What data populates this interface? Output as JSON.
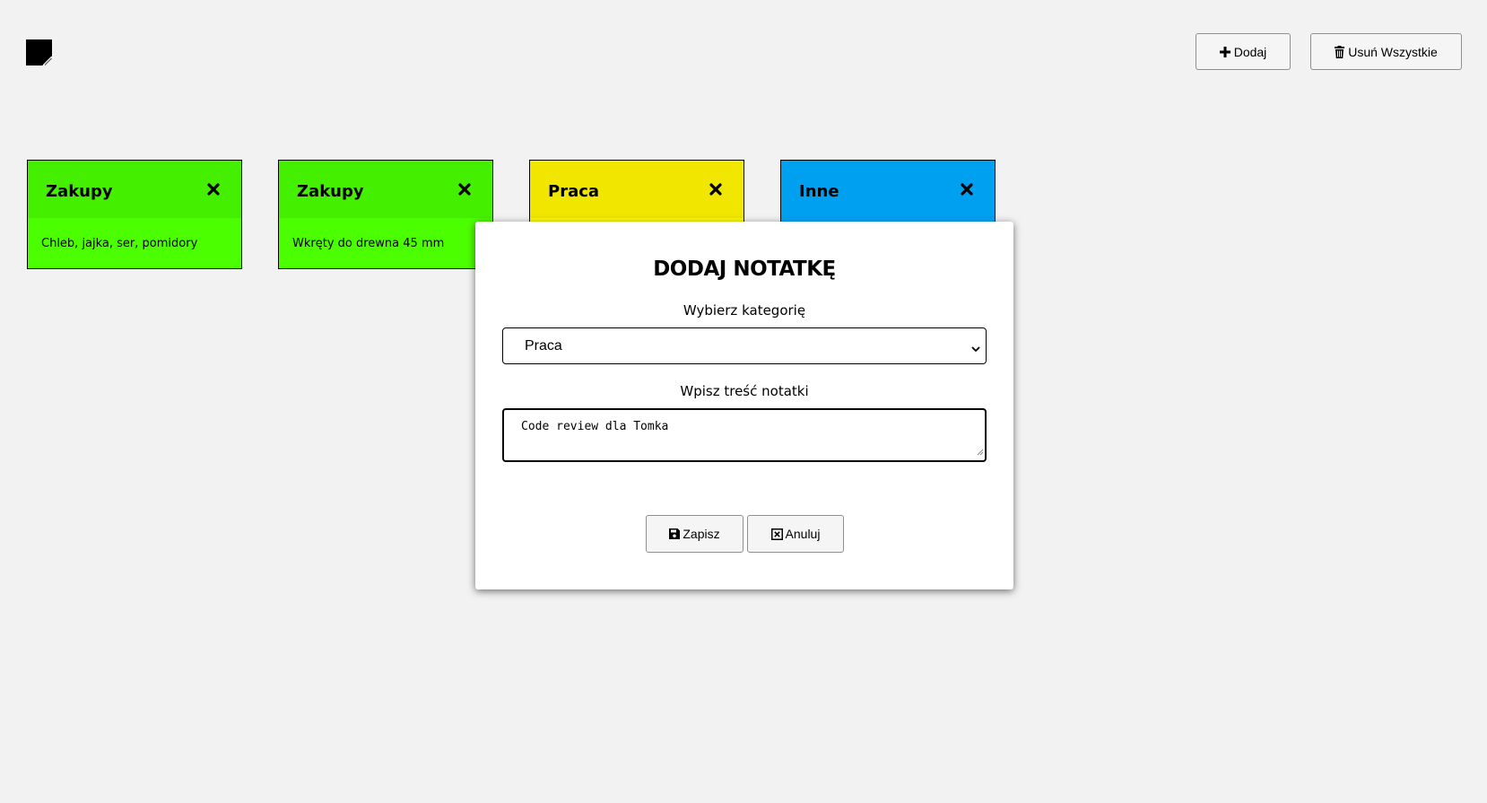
{
  "header": {
    "logo_icon": "sticky-note-icon",
    "add_button": {
      "label": "Dodaj",
      "icon": "plus-icon"
    },
    "delete_all_button": {
      "label": "Usuń Wszystkie",
      "icon": "trash-icon"
    }
  },
  "notes": [
    {
      "category": "Zakupy",
      "content": "Chleb, jajka, ser, pomidory",
      "color": "#4cff00"
    },
    {
      "category": "Zakupy",
      "content": "Wkręty do drewna 45 mm",
      "color": "#4cff00"
    },
    {
      "category": "Praca",
      "content": "",
      "color": "#ffff00"
    },
    {
      "category": "Inne",
      "content": "",
      "color": "#00aaff"
    }
  ],
  "modal": {
    "title": "DODAJ NOTATKĘ",
    "category_label": "Wybierz kategorię",
    "category_selected": "Praca",
    "content_label": "Wpisz treść notatki",
    "content_value": "Code review dla Tomka",
    "save_button": {
      "label": "Zapisz",
      "icon": "floppy-disk-icon"
    },
    "cancel_button": {
      "label": "Anuluj",
      "icon": "square-x-icon"
    }
  }
}
